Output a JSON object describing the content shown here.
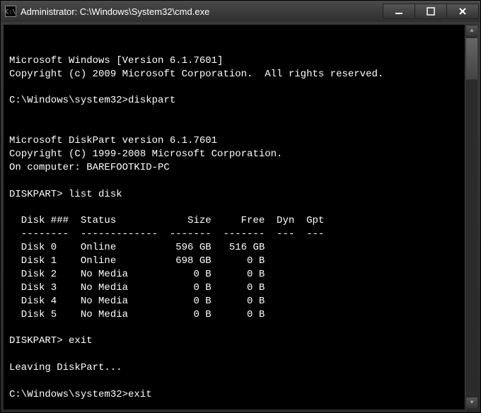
{
  "titlebar": {
    "icon_label": "C:\\",
    "title": "Administrator: C:\\Windows\\System32\\cmd.exe"
  },
  "console": {
    "header1": "Microsoft Windows [Version 6.1.7601]",
    "header2": "Copyright (c) 2009 Microsoft Corporation.  All rights reserved.",
    "prompt1": "C:\\Windows\\system32>",
    "cmd1": "diskpart",
    "dp_header1": "Microsoft DiskPart version 6.1.7601",
    "dp_header2": "Copyright (C) 1999-2008 Microsoft Corporation.",
    "dp_computer": "On computer: BAREFOOTKID-PC",
    "dp_prompt1": "DISKPART> ",
    "dp_cmd1": "list disk",
    "table": {
      "headers": [
        "Disk ###",
        "Status",
        "Size",
        "Free",
        "Dyn",
        "Gpt"
      ],
      "rows": [
        {
          "id": "Disk 0",
          "status": "Online",
          "size": "596 GB",
          "free": "516 GB",
          "dyn": "",
          "gpt": ""
        },
        {
          "id": "Disk 1",
          "status": "Online",
          "size": "698 GB",
          "free": "0 B",
          "dyn": "",
          "gpt": ""
        },
        {
          "id": "Disk 2",
          "status": "No Media",
          "size": "0 B",
          "free": "0 B",
          "dyn": "",
          "gpt": ""
        },
        {
          "id": "Disk 3",
          "status": "No Media",
          "size": "0 B",
          "free": "0 B",
          "dyn": "",
          "gpt": ""
        },
        {
          "id": "Disk 4",
          "status": "No Media",
          "size": "0 B",
          "free": "0 B",
          "dyn": "",
          "gpt": ""
        },
        {
          "id": "Disk 5",
          "status": "No Media",
          "size": "0 B",
          "free": "0 B",
          "dyn": "",
          "gpt": ""
        }
      ],
      "chart_data": {
        "type": "table",
        "columns": [
          "Disk ###",
          "Status",
          "Size",
          "Free",
          "Dyn",
          "Gpt"
        ],
        "rows": [
          [
            "Disk 0",
            "Online",
            "596 GB",
            "516 GB",
            "",
            ""
          ],
          [
            "Disk 1",
            "Online",
            "698 GB",
            "0 B",
            "",
            ""
          ],
          [
            "Disk 2",
            "No Media",
            "0 B",
            "0 B",
            "",
            ""
          ],
          [
            "Disk 3",
            "No Media",
            "0 B",
            "0 B",
            "",
            ""
          ],
          [
            "Disk 4",
            "No Media",
            "0 B",
            "0 B",
            "",
            ""
          ],
          [
            "Disk 5",
            "No Media",
            "0 B",
            "0 B",
            "",
            ""
          ]
        ]
      }
    },
    "dp_prompt2": "DISKPART> ",
    "dp_cmd2": "exit",
    "dp_leaving": "Leaving DiskPart...",
    "prompt2": "C:\\Windows\\system32>",
    "cmd2": "exit"
  }
}
